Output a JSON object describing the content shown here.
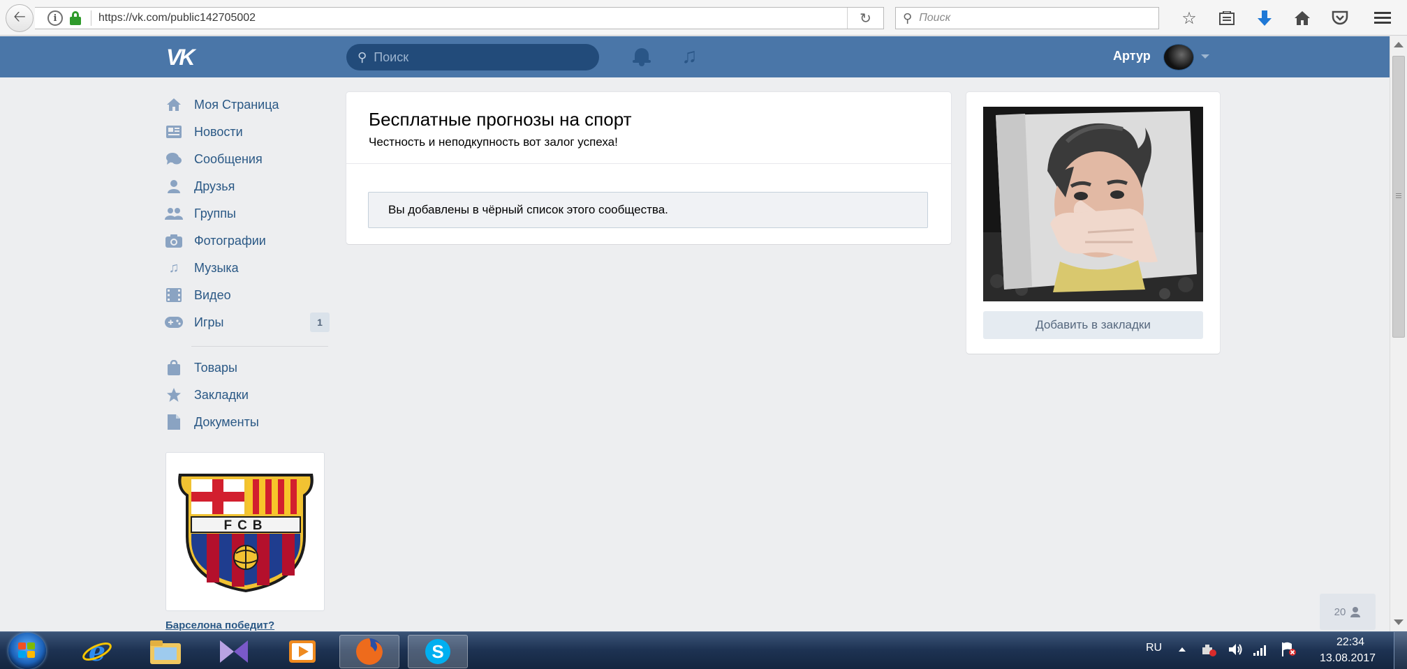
{
  "browser": {
    "url": "https://vk.com/public142705002",
    "search_placeholder": "Поиск",
    "icons": [
      "back-arrow-icon",
      "info-icon",
      "lock-icon",
      "reload-icon",
      "search-icon",
      "bookmark-star-icon",
      "reading-list-icon",
      "download-icon",
      "home-icon",
      "pocket-icon",
      "hamburger-menu-icon"
    ]
  },
  "vk_header": {
    "logo": "VK",
    "search_placeholder": "Поиск",
    "user_name": "Артур"
  },
  "sidebar": {
    "items": [
      {
        "label": "Моя Страница",
        "icon": "home-icon"
      },
      {
        "label": "Новости",
        "icon": "news-icon"
      },
      {
        "label": "Сообщения",
        "icon": "messages-icon"
      },
      {
        "label": "Друзья",
        "icon": "friends-icon"
      },
      {
        "label": "Группы",
        "icon": "groups-icon"
      },
      {
        "label": "Фотографии",
        "icon": "camera-icon"
      },
      {
        "label": "Музыка",
        "icon": "music-icon"
      },
      {
        "label": "Видео",
        "icon": "video-icon"
      },
      {
        "label": "Игры",
        "icon": "games-icon",
        "badge": "1"
      },
      {
        "label": "Товары",
        "icon": "shopping-bag-icon"
      },
      {
        "label": "Закладки",
        "icon": "star-icon"
      },
      {
        "label": "Документы",
        "icon": "document-icon"
      }
    ],
    "ad_logo_text": "FCB",
    "ad_link": "Барселона победит?"
  },
  "community": {
    "title": "Бесплатные прогнозы на спорт",
    "status": "Честность и неподкупность вот залог успеха!",
    "notice": "Вы добавлены в чёрный список этого сообщества.",
    "bookmark_button": "Добавить в закладки"
  },
  "online_widget": {
    "count": "20"
  },
  "taskbar": {
    "language": "RU",
    "time": "22:34",
    "date": "13.08.2017"
  },
  "colors": {
    "vk_blue": "#4a76a8",
    "vk_link": "#2a5885",
    "page_bg": "#edeef0"
  }
}
